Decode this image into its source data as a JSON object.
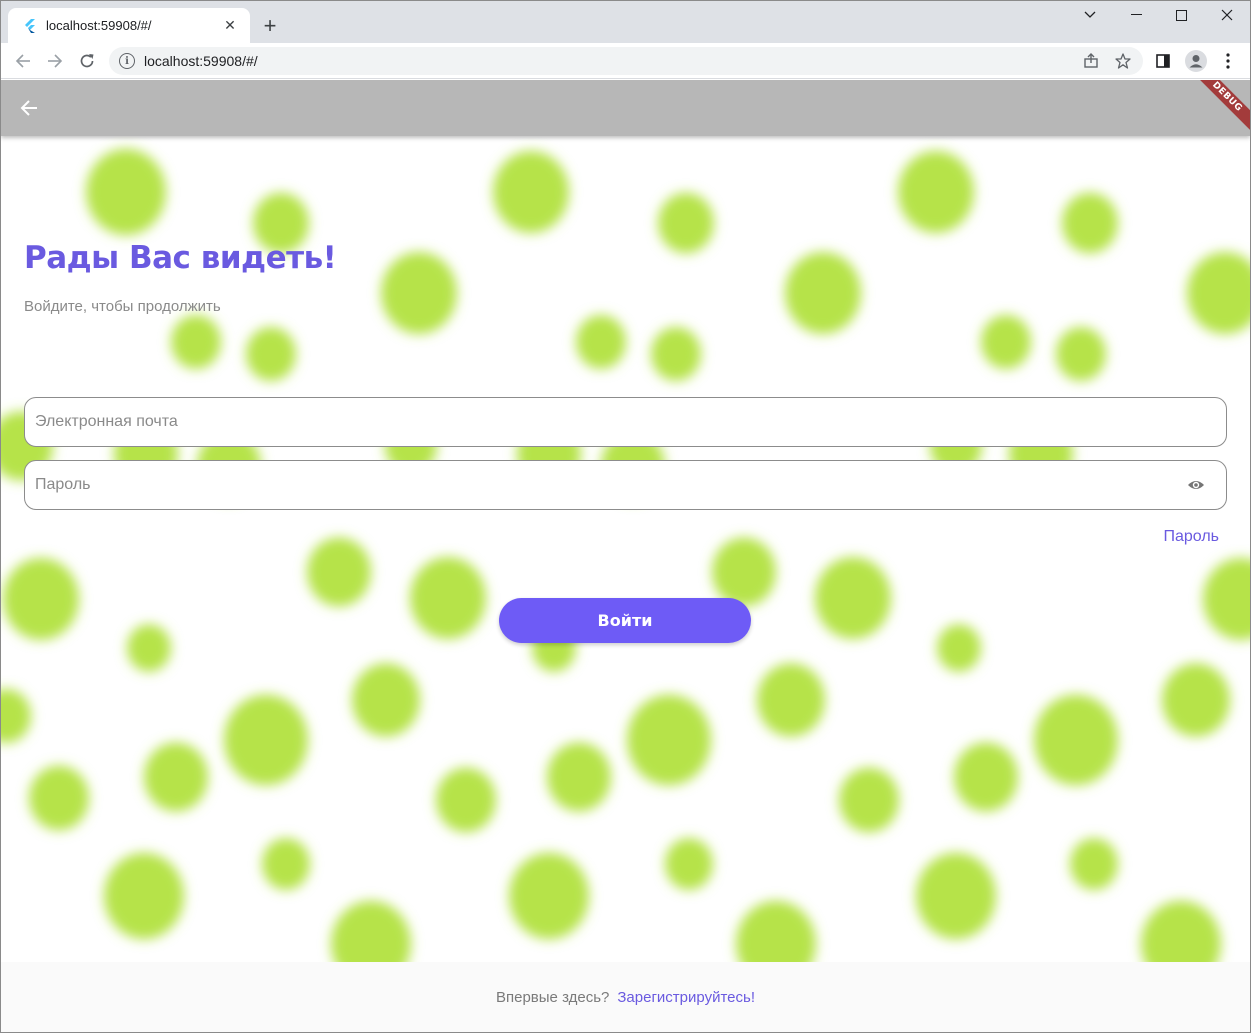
{
  "browser": {
    "tab_title": "localhost:59908/#/",
    "url": "localhost:59908/#/",
    "new_tab_glyph": "+",
    "close_tab_glyph": "✕",
    "icons": [
      "flutter-favicon",
      "back-arrow-icon",
      "forward-arrow-icon",
      "reload-icon",
      "info-icon",
      "share-icon",
      "star-icon",
      "side-panel-icon",
      "profile-icon",
      "kebab-menu-icon",
      "chevron-down-icon",
      "minimize-icon",
      "maximize-icon",
      "close-icon"
    ]
  },
  "appbar": {
    "debug_label": "DEBUG",
    "background": "#b7b7b7"
  },
  "login": {
    "title": "Рады Вас видеть!",
    "subtitle": "Войдите, чтобы продолжить",
    "email_placeholder": "Электронная почта",
    "password_placeholder": "Пароль",
    "forgot_link": "Пароль",
    "submit_label": "Войти"
  },
  "footer": {
    "question": "Впервые здесь?",
    "register_link": "Зарегистрируйтесь!"
  },
  "colors": {
    "accent": "#6a5ae0",
    "button": "#6e5bf6",
    "blob": "#b6e34a"
  }
}
